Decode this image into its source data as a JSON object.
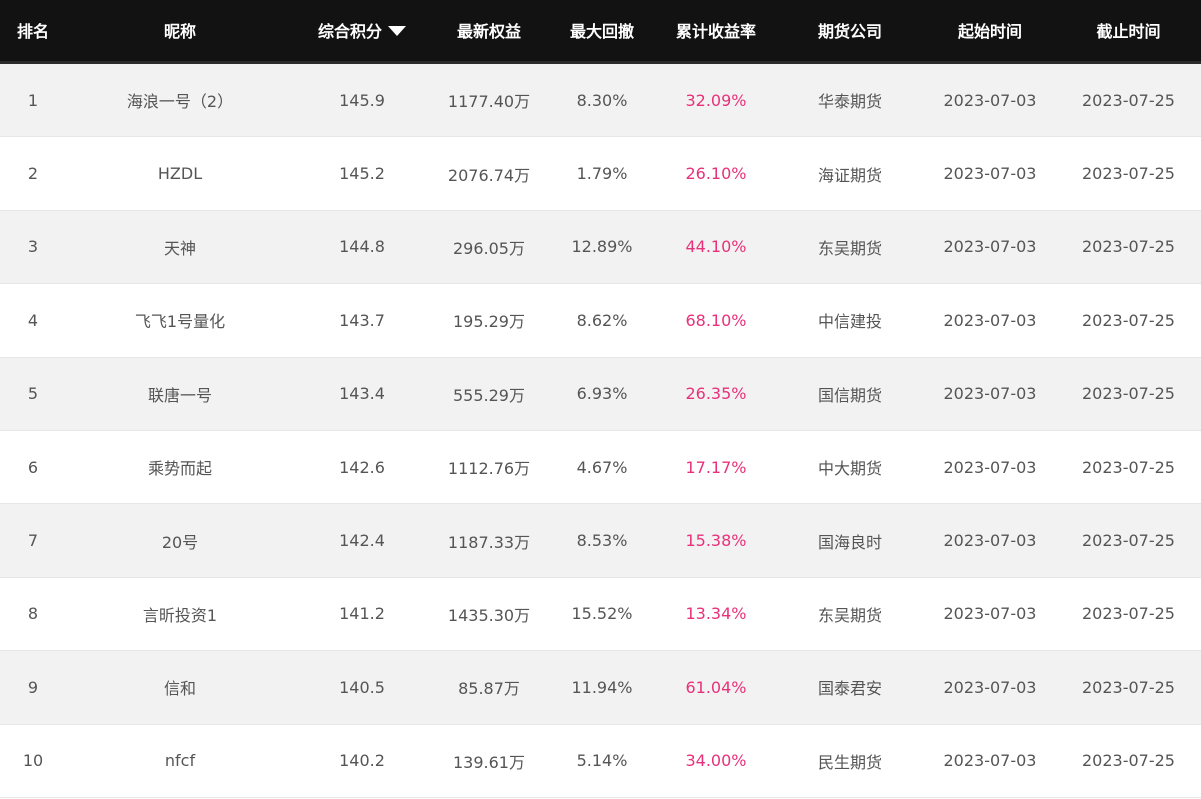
{
  "header": {
    "rank": "排名",
    "nickname": "昵称",
    "score": "综合积分",
    "equity": "最新权益",
    "drawdown": "最大回撤",
    "return_rate": "累计收益率",
    "company": "期货公司",
    "start": "起始时间",
    "end": "截止时间"
  },
  "sort": {
    "column": "score",
    "direction": "descending",
    "icon": "caret-down-icon"
  },
  "colors": {
    "header_bg": "#121212",
    "row_odd": "#f2f2f2",
    "row_even": "#ffffff",
    "text": "#555555",
    "return_rate": "#e8317a"
  },
  "rows": [
    {
      "rank": "1",
      "nickname": "海浪一号（2）",
      "score": "145.9",
      "equity": "1177.40万",
      "drawdown": "8.30%",
      "return_rate": "32.09%",
      "company": "华泰期货",
      "start": "2023-07-03",
      "end": "2023-07-25"
    },
    {
      "rank": "2",
      "nickname": "HZDL",
      "score": "145.2",
      "equity": "2076.74万",
      "drawdown": "1.79%",
      "return_rate": "26.10%",
      "company": "海证期货",
      "start": "2023-07-03",
      "end": "2023-07-25"
    },
    {
      "rank": "3",
      "nickname": "天神",
      "score": "144.8",
      "equity": "296.05万",
      "drawdown": "12.89%",
      "return_rate": "44.10%",
      "company": "东吴期货",
      "start": "2023-07-03",
      "end": "2023-07-25"
    },
    {
      "rank": "4",
      "nickname": "飞飞1号量化",
      "score": "143.7",
      "equity": "195.29万",
      "drawdown": "8.62%",
      "return_rate": "68.10%",
      "company": "中信建投",
      "start": "2023-07-03",
      "end": "2023-07-25"
    },
    {
      "rank": "5",
      "nickname": "联唐一号",
      "score": "143.4",
      "equity": "555.29万",
      "drawdown": "6.93%",
      "return_rate": "26.35%",
      "company": "国信期货",
      "start": "2023-07-03",
      "end": "2023-07-25"
    },
    {
      "rank": "6",
      "nickname": "乘势而起",
      "score": "142.6",
      "equity": "1112.76万",
      "drawdown": "4.67%",
      "return_rate": "17.17%",
      "company": "中大期货",
      "start": "2023-07-03",
      "end": "2023-07-25"
    },
    {
      "rank": "7",
      "nickname": "20号",
      "score": "142.4",
      "equity": "1187.33万",
      "drawdown": "8.53%",
      "return_rate": "15.38%",
      "company": "国海良时",
      "start": "2023-07-03",
      "end": "2023-07-25"
    },
    {
      "rank": "8",
      "nickname": "言昕投资1",
      "score": "141.2",
      "equity": "1435.30万",
      "drawdown": "15.52%",
      "return_rate": "13.34%",
      "company": "东吴期货",
      "start": "2023-07-03",
      "end": "2023-07-25"
    },
    {
      "rank": "9",
      "nickname": "信和",
      "score": "140.5",
      "equity": "85.87万",
      "drawdown": "11.94%",
      "return_rate": "61.04%",
      "company": "国泰君安",
      "start": "2023-07-03",
      "end": "2023-07-25"
    },
    {
      "rank": "10",
      "nickname": "nfcf",
      "score": "140.2",
      "equity": "139.61万",
      "drawdown": "5.14%",
      "return_rate": "34.00%",
      "company": "民生期货",
      "start": "2023-07-03",
      "end": "2023-07-25"
    }
  ]
}
